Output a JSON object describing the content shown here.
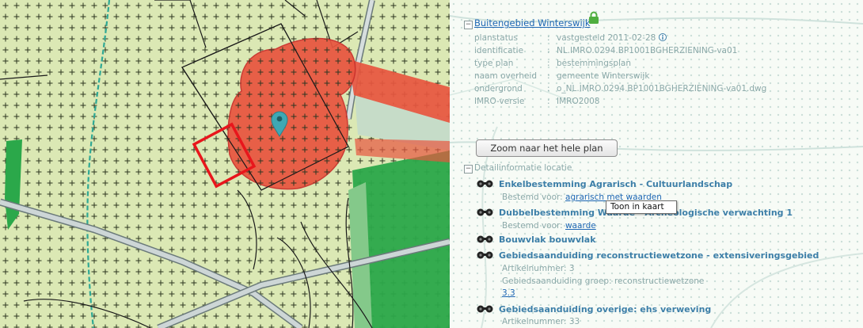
{
  "plan": {
    "title": "Buitengebied Winterswijk",
    "properties": [
      {
        "key": "planstatus",
        "value": "vastgesteld 2011-02-28"
      },
      {
        "key": "identificatie",
        "value": "NL.IMRO.0294.BP1001BGHERZIENING-va01"
      },
      {
        "key": "type plan",
        "value": "bestemmingsplan"
      },
      {
        "key": "naam overheid",
        "value": "gemeente Winterswijk"
      },
      {
        "key": "ondergrond",
        "value": "o_NL.IMRO.0294.BP1001BGHERZIENING-va01.dwg"
      },
      {
        "key": "IMRO-versie",
        "value": "IMRO2008"
      }
    ],
    "zoom_button_label": "Zoom naar het hele plan"
  },
  "details": {
    "section_title": "Detailinformatie locatie",
    "items": [
      {
        "title": "Enkelbestemming Agrarisch - Cultuurlandschap",
        "sub_prefix": "Bestemd voor:",
        "sub_link": "agrarisch met waarden"
      },
      {
        "title": "Dubbelbestemming Waarde - Archeologische verwachting 1",
        "sub_prefix": "Bestemd voor:",
        "sub_link": "waarde"
      },
      {
        "title": "Bouwvlak bouwvlak"
      },
      {
        "title": "Gebiedsaanduiding reconstructiewetzone - extensiveringsgebied",
        "lines": [
          "Artikelnummer: 3",
          "Gebiedsaanduiding groep: reconstructiewetzone"
        ],
        "link": "3.3"
      },
      {
        "title": "Gebiedsaanduiding overige: ehs verweving",
        "lines": [
          "Artikelnummer: 33"
        ]
      }
    ],
    "tooltip": "Toon in kaart"
  },
  "icons": {
    "lock": "lock-icon",
    "info": "info-icon",
    "eye": "eye-icon",
    "pin": "map-pin-icon",
    "toggle": "tree-toggle-icon"
  },
  "colors": {
    "map_base": "#dbe8b4",
    "plus_marks": "#2c3620",
    "selected_area": "#e8553f",
    "selected_area_border": "#c9302c",
    "ehs_green": "#2ba84a",
    "stream": "#2fa894",
    "highlight_box": "#e8161c",
    "pin": "#3fa8b4",
    "link": "#1d66b3",
    "item_title": "#3d7fa8",
    "muted_text": "#8aa8a8",
    "lock": "#4fae3f"
  }
}
